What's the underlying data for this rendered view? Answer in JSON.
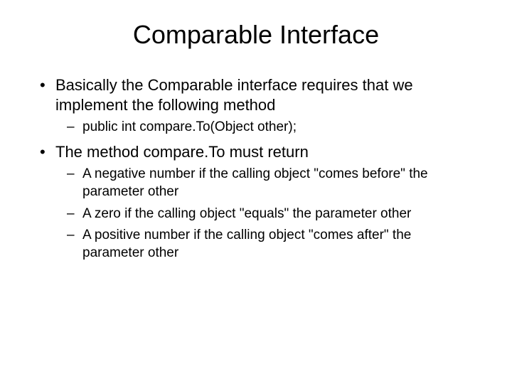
{
  "title": "Comparable Interface",
  "bullets": [
    {
      "text": "Basically the Comparable interface requires that we implement the following method",
      "sub": [
        "public int compare.To(Object other);"
      ]
    },
    {
      "text": "The method compare.To must return",
      "sub": [
        "A negative number if the calling object \"comes before\" the parameter other",
        "A zero if the calling object \"equals\" the parameter other",
        "A positive number if the calling object \"comes after\" the parameter other"
      ]
    }
  ]
}
